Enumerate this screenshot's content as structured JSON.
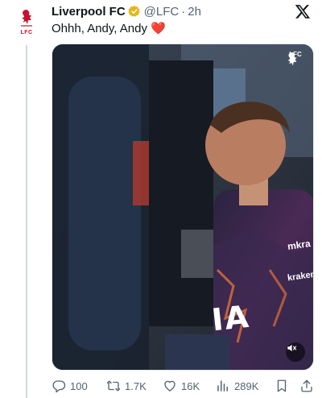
{
  "account": {
    "name": "Liverpool FC",
    "handle": "@LFC",
    "separator": "·",
    "time": "2h",
    "avatar_text": "LFC",
    "verified": true
  },
  "tweet": {
    "text": "Ohhh, Andy, Andy",
    "emoji": "❤️"
  },
  "media": {
    "watermark_text": "LFC",
    "shirt_sponsor": "mkra",
    "shirt_sponsor_sub": "kraken",
    "shirt_text": "IA",
    "muted": true
  },
  "actions": {
    "replies": "100",
    "reposts": "1.7K",
    "likes": "16K",
    "views": "289K"
  },
  "icons": {
    "logo": "x-logo-icon",
    "verified": "verified-badge-icon",
    "reply": "reply-icon",
    "repost": "repost-icon",
    "like": "heart-icon",
    "views": "views-icon",
    "bookmark": "bookmark-icon",
    "share": "share-icon",
    "mute": "mute-icon"
  },
  "colors": {
    "brand_red": "#c8102e",
    "verified_gold": "#e2b719",
    "secondary_text": "#536471",
    "heart": "#e0245e"
  }
}
